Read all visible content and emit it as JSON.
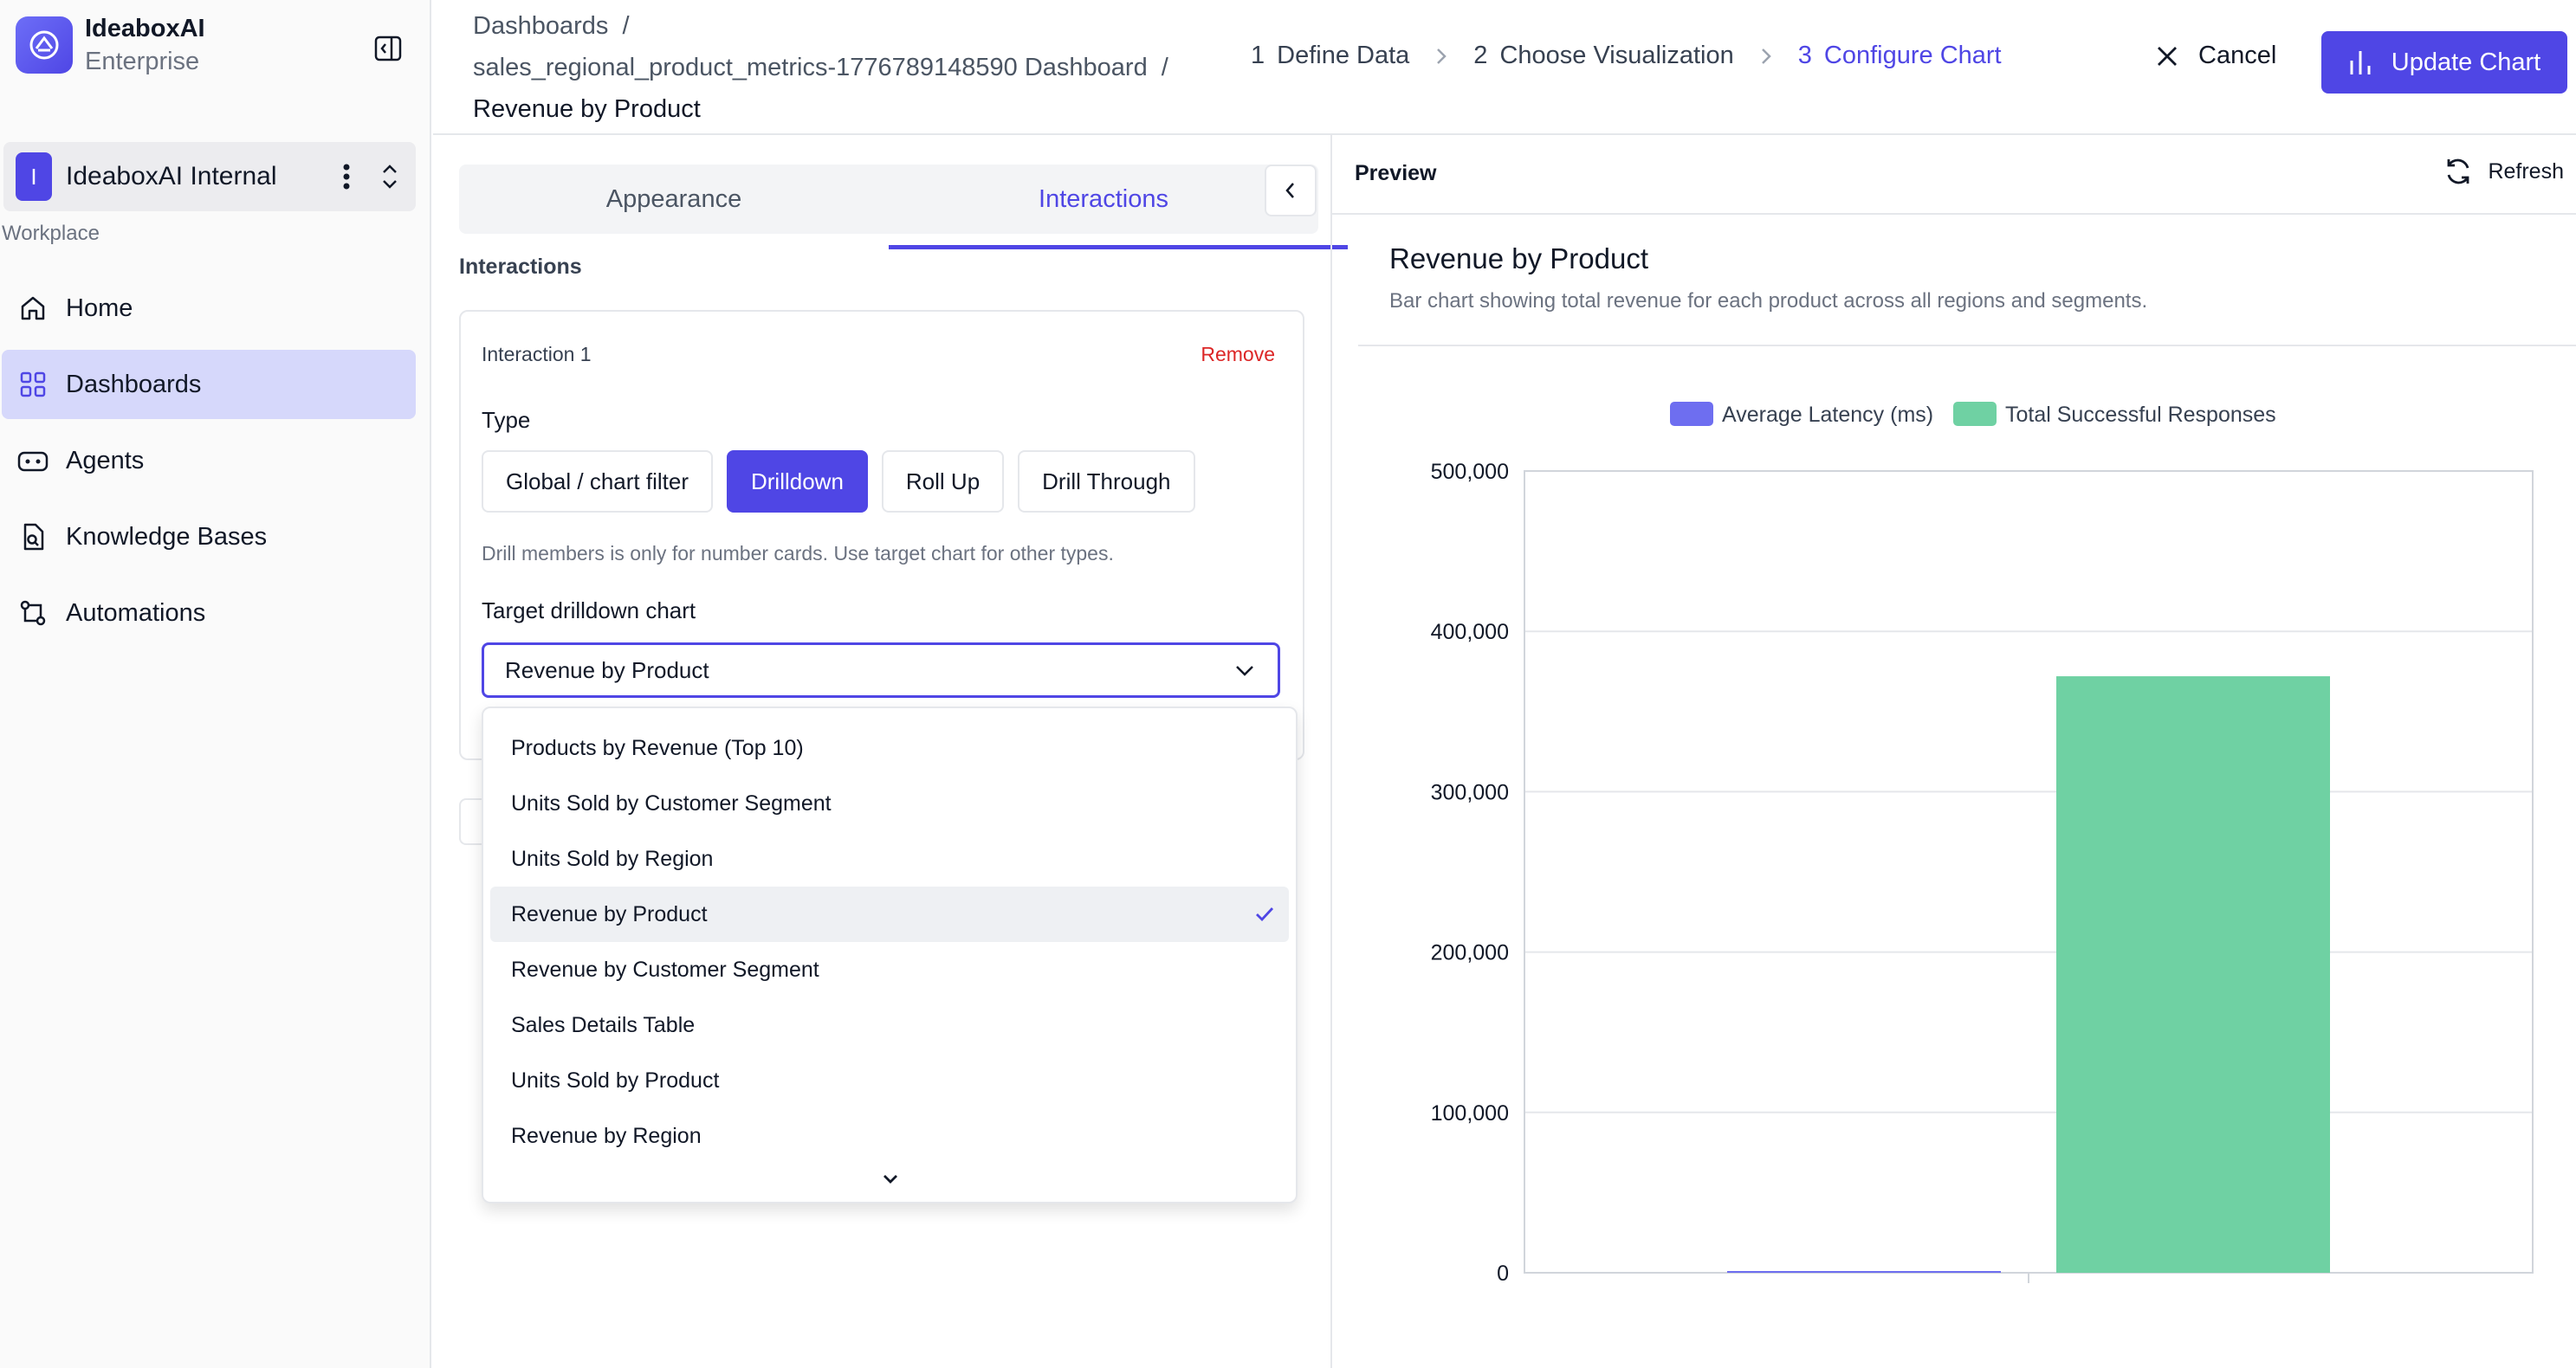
{
  "brand": {
    "name": "IdeaboxAI",
    "edition": "Enterprise"
  },
  "org": {
    "initial": "I",
    "name": "IdeaboxAI Internal"
  },
  "sidebar": {
    "section_label": "Workplace",
    "items": [
      {
        "label": "Home",
        "icon": "home-icon",
        "active": false
      },
      {
        "label": "Dashboards",
        "icon": "dashboard-grid-icon",
        "active": true
      },
      {
        "label": "Agents",
        "icon": "robot-icon",
        "active": false
      },
      {
        "label": "Knowledge Bases",
        "icon": "file-search-icon",
        "active": false
      },
      {
        "label": "Automations",
        "icon": "workflow-icon",
        "active": false
      }
    ]
  },
  "breadcrumb": {
    "root": "Dashboards",
    "dashboard": "sales_regional_product_metrics-1776789148590 Dashboard",
    "current": "Revenue by Product",
    "separator": "/"
  },
  "steps": [
    {
      "num": "1",
      "label": "Define Data",
      "active": false
    },
    {
      "num": "2",
      "label": "Choose Visualization",
      "active": false
    },
    {
      "num": "3",
      "label": "Configure Chart",
      "active": true
    }
  ],
  "actions": {
    "cancel": "Cancel",
    "update": "Update Chart"
  },
  "config": {
    "tabs": [
      {
        "label": "Appearance",
        "active": false
      },
      {
        "label": "Interactions",
        "active": true
      }
    ],
    "section_title": "Interactions",
    "interaction": {
      "title": "Interaction 1",
      "remove": "Remove",
      "type_label": "Type",
      "types": [
        {
          "label": "Global / chart filter",
          "active": false
        },
        {
          "label": "Drilldown",
          "active": true
        },
        {
          "label": "Roll Up",
          "active": false
        },
        {
          "label": "Drill Through",
          "active": false
        }
      ],
      "hint": "Drill members is only for number cards. Use target chart for other types.",
      "target_label": "Target drilldown chart",
      "target_value": "Revenue by Product"
    },
    "dropdown_options": [
      {
        "label": "Products by Revenue (Top 10)",
        "selected": false
      },
      {
        "label": "Units Sold by Customer Segment",
        "selected": false
      },
      {
        "label": "Units Sold by Region",
        "selected": false
      },
      {
        "label": "Revenue by Product",
        "selected": true
      },
      {
        "label": "Revenue by Customer Segment",
        "selected": false
      },
      {
        "label": "Sales Details Table",
        "selected": false
      },
      {
        "label": "Units Sold by Product",
        "selected": false
      },
      {
        "label": "Revenue by Region",
        "selected": false
      }
    ]
  },
  "preview": {
    "label": "Preview",
    "refresh": "Refresh",
    "chart_title": "Revenue by Product",
    "chart_subtitle": "Bar chart showing total revenue for each product across all regions and segments."
  },
  "chart_data": {
    "type": "bar",
    "categories": [
      ""
    ],
    "series": [
      {
        "name": "Average Latency (ms)",
        "values": [
          0
        ],
        "color": "#6e6ef0"
      },
      {
        "name": "Total Successful Responses",
        "values": [
          372000
        ],
        "color": "#6fd1a3"
      }
    ],
    "ylim": [
      0,
      500000
    ],
    "yticks": [
      "0",
      "100,000",
      "200,000",
      "300,000",
      "400,000",
      "500,000"
    ],
    "ytick_values": [
      0,
      100000,
      200000,
      300000,
      400000,
      500000
    ],
    "legend": "top-center",
    "grid": true
  },
  "colors": {
    "accent": "#4f46e5",
    "danger": "#dc2626",
    "active_nav": "#d6d8fb"
  }
}
